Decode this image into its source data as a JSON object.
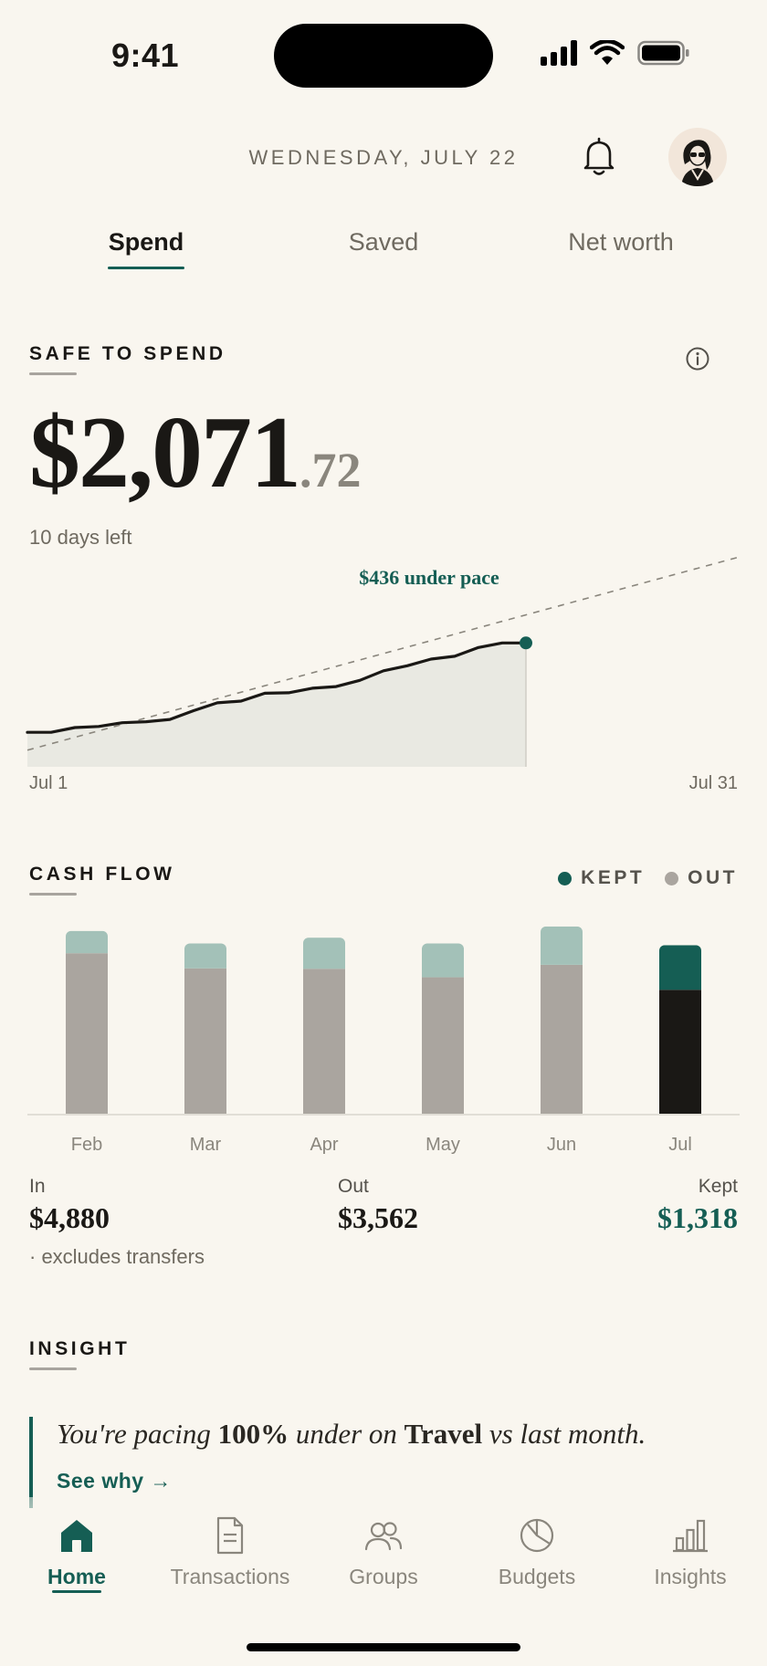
{
  "status_bar": {
    "time": "9:41"
  },
  "header": {
    "date": "WEDNESDAY, JULY 22"
  },
  "tabs": [
    {
      "label": "Spend",
      "active": true
    },
    {
      "label": "Saved",
      "active": false
    },
    {
      "label": "Net worth",
      "active": false
    }
  ],
  "safe_to_spend": {
    "label": "SAFE TO SPEND",
    "amount_whole": "$2,071",
    "amount_cents": ".72",
    "days_left": "10 days left",
    "pace_annotation": "$436 under pace",
    "start_label": "Jul 1",
    "end_label": "Jul 31"
  },
  "cash_flow": {
    "label": "CASH FLOW",
    "legend": [
      {
        "label": "KEPT",
        "color": "#155e54"
      },
      {
        "label": "OUT",
        "color": "#aaa59f"
      }
    ],
    "in_label": "In",
    "in_value": "$4,880",
    "out_label": "Out",
    "out_value": "$3,562",
    "kept_label": "Kept",
    "kept_value": "$1,318",
    "footnote": "· excludes transfers"
  },
  "chart_data": [
    {
      "type": "line",
      "x": [
        1,
        2,
        3,
        4,
        5,
        6,
        7,
        8,
        9,
        10,
        11,
        12,
        13,
        14,
        15,
        16,
        17,
        18,
        19,
        20,
        21,
        22
      ],
      "series": [
        {
          "values": [
            2080,
            2080,
            2195,
            2220,
            2310,
            2335,
            2390,
            2600,
            2790,
            2830,
            3020,
            3030,
            3140,
            3180,
            3330,
            3560,
            3680,
            3840,
            3910,
            4120,
            4230,
            4230
          ]
        }
      ],
      "pace": {
        "x": [
          1,
          31
        ],
        "values": [
          1650,
          6300
        ]
      },
      "ylim": [
        1250,
        6300
      ],
      "xlim": [
        1,
        31
      ]
    },
    {
      "type": "bar",
      "categories": [
        "Feb",
        "Mar",
        "Apr",
        "May",
        "Jun",
        "Jul"
      ],
      "series": [
        {
          "name": "OUT",
          "values": [
            3600,
            3260,
            3250,
            3060,
            3340,
            2780
          ]
        },
        {
          "name": "KEPT",
          "values": [
            500,
            560,
            700,
            760,
            860,
            1000
          ]
        }
      ],
      "highlight_category": "Jul",
      "ylim": [
        0,
        4300
      ]
    }
  ],
  "insight": {
    "label": "INSIGHT",
    "text_prefix": "You're pacing ",
    "text_strong": "100%",
    "text_mid": " under on ",
    "text_category": "Travel",
    "text_suffix": " vs last month.",
    "link": "See why →"
  },
  "nav": [
    {
      "label": "Home",
      "icon": "home-icon",
      "active": true
    },
    {
      "label": "Transactions",
      "icon": "receipt-icon",
      "active": false
    },
    {
      "label": "Groups",
      "icon": "people-icon",
      "active": false
    },
    {
      "label": "Budgets",
      "icon": "pie-icon",
      "active": false
    },
    {
      "label": "Insights",
      "icon": "bar-chart-icon",
      "active": false
    }
  ],
  "colors": {
    "accent": "#155e54",
    "accent_light": "#a3c1b8",
    "out_gray": "#aaa59f",
    "highlight_out": "#1a1815",
    "background": "#f9f6ef"
  }
}
